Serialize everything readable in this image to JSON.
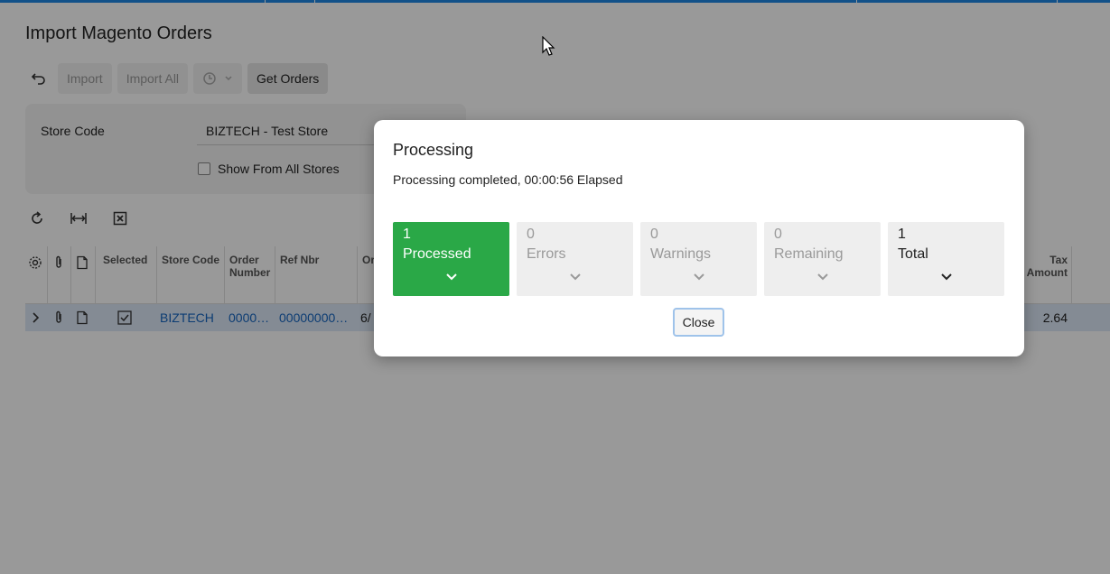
{
  "page": {
    "title": "Import Magento Orders"
  },
  "toolbar": {
    "import_label": "Import",
    "import_all_label": "Import All",
    "get_orders_label": "Get Orders"
  },
  "filter": {
    "store_code_label": "Store Code",
    "store_code_value": "BIZTECH - Test Store",
    "show_all_label": "Show From All Stores"
  },
  "grid": {
    "columns": {
      "selected": "Selected",
      "store_code": "Store Code",
      "order_number": "Order Number",
      "ref_nbr": "Ref Nbr",
      "or_prefix": "Or",
      "tax_amount": "Tax Amount"
    },
    "row": {
      "store_code": "BIZTECH",
      "order_number": "0000…",
      "ref_nbr": "00000000…",
      "date_prefix": "6/",
      "tax_amount": "2.64"
    }
  },
  "dialog": {
    "title": "Processing",
    "message": "Processing completed, 00:00:56 Elapsed",
    "tiles": [
      {
        "count": "1",
        "label": "Processed"
      },
      {
        "count": "0",
        "label": "Errors"
      },
      {
        "count": "0",
        "label": "Warnings"
      },
      {
        "count": "0",
        "label": "Remaining"
      },
      {
        "count": "1",
        "label": "Total"
      }
    ],
    "close_label": "Close"
  },
  "colors": {
    "accent": "#1e88e5",
    "processed_green": "#2aa847",
    "selected_row": "#dde8f7"
  }
}
